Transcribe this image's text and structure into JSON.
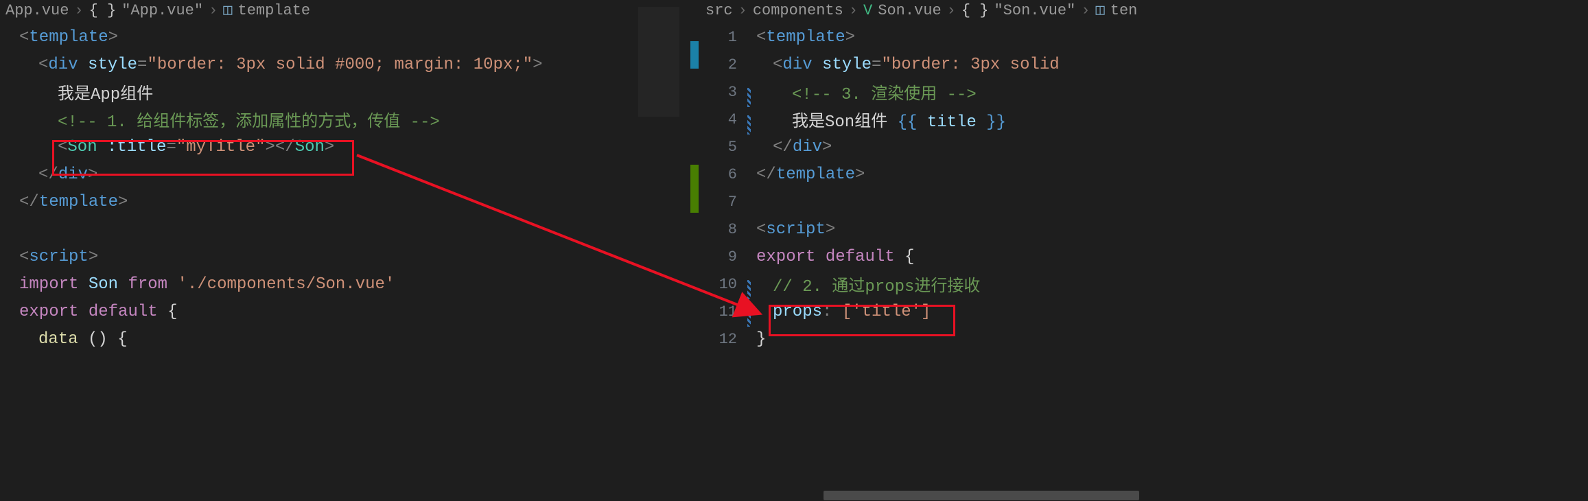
{
  "left": {
    "breadcrumb": {
      "file": "App.vue",
      "scope": "\"App.vue\"",
      "node": "template"
    },
    "lines": {
      "l1_tag": "template",
      "l2_tag": "div",
      "l2_attr": "style",
      "l2_val": "\"border: 3px solid #000; margin: 10px;\"",
      "l3_text": "我是App组件",
      "l4_comment": "<!-- 1. 给组件标签，添加属性的方式，传值 -->",
      "l5_tag": "Son",
      "l5_attr": ":title",
      "l5_val": "\"myTitle\"",
      "l6_close_div": "div",
      "l7_close_tpl": "template",
      "l8_script": "script",
      "l9_import": "import",
      "l9_ident": "Son",
      "l9_from": "from",
      "l9_path": "'./components/Son.vue'",
      "l10_export": "export",
      "l10_default": "default",
      "l11_data": "data",
      "l11_paren": "()"
    }
  },
  "right": {
    "breadcrumb": {
      "p1": "src",
      "p2": "components",
      "file": "Son.vue",
      "scope": "\"Son.vue\"",
      "tail": "ten"
    },
    "lines": {
      "n1": "1",
      "n2": "2",
      "n3": "3",
      "n4": "4",
      "n5": "5",
      "n6": "6",
      "n7": "7",
      "n8": "8",
      "n9": "9",
      "n10": "10",
      "n11": "11",
      "n12": "12",
      "l1_tag": "template",
      "l2_tag": "div",
      "l2_attr": "style",
      "l2_val": "\"border: 3px solid",
      "l3_comment": "<!-- 3. 渲染使用 -->",
      "l4_text_a": "我是Son组件 ",
      "l4_mleft": "{{",
      "l4_ident": " title ",
      "l4_mright": "}}",
      "l5_close_div": "div",
      "l6_close_tpl": "template",
      "l8_script": "script",
      "l9_export": "export",
      "l9_default": "default",
      "l10_comment": "// 2. 通过props进行接收",
      "l11_key": "props",
      "l11_val": "['title']",
      "l12_brace": "}"
    }
  }
}
